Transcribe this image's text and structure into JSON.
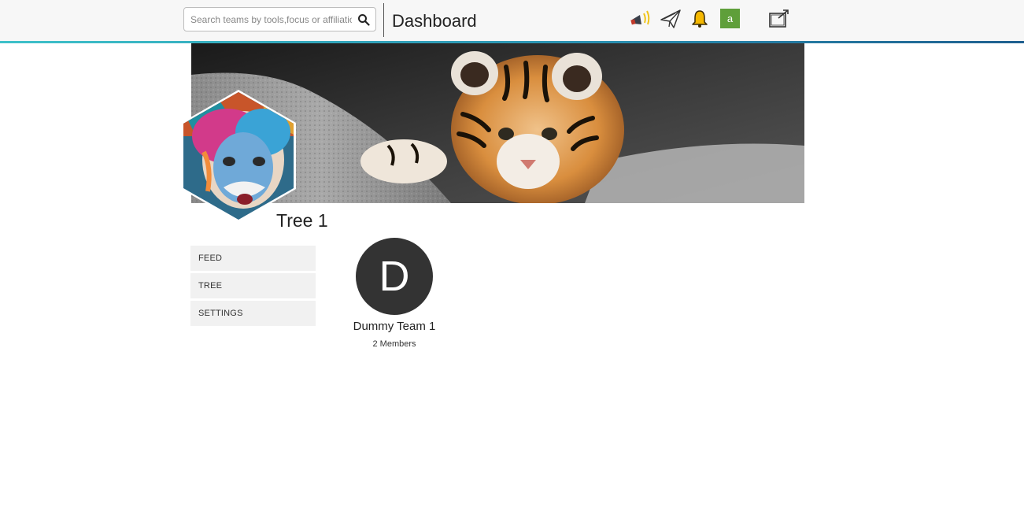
{
  "header": {
    "search": {
      "placeholder": "Search teams by tools,focus or affiliation",
      "value": ""
    },
    "title": "Dashboard",
    "icons": [
      "megaphone-icon",
      "paper-plane-icon",
      "bell-icon",
      "external-window-icon"
    ],
    "avatar_letter": "a",
    "accent_line": "#2a8fb0",
    "avatar_color": "#5f9f3a"
  },
  "tree": {
    "title": "Tree 1"
  },
  "menu": {
    "items": [
      {
        "label": "FEED"
      },
      {
        "label": "TREE"
      },
      {
        "label": "SETTINGS"
      }
    ]
  },
  "teams": [
    {
      "initial": "D",
      "name": "Dummy Team 1",
      "members": "2 Members"
    }
  ]
}
